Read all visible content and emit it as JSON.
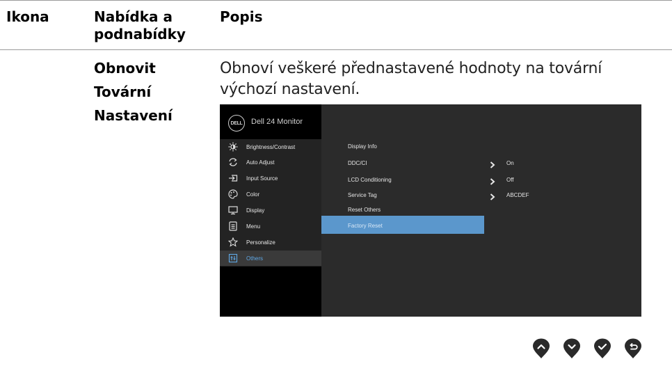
{
  "table": {
    "headers": {
      "icon": "Ikona",
      "menu_line1": "Nabídka a",
      "menu_line2": "podnabídky",
      "desc": "Popis"
    },
    "row": {
      "menu_lines": [
        "Obnovit",
        "Tovární",
        "Nastavení"
      ],
      "desc_lines": [
        "Obnoví veškeré přednastavené hodnoty na tovární",
        "výchozí nastavení."
      ]
    }
  },
  "osd": {
    "logo": "DELL",
    "title": "Dell 24 Monitor",
    "left_menu": [
      {
        "icon": "brightness-icon",
        "label": "Brightness/Contrast"
      },
      {
        "icon": "auto-adjust-icon",
        "label": "Auto Adjust"
      },
      {
        "icon": "input-source-icon",
        "label": "Input Source"
      },
      {
        "icon": "color-palette-icon",
        "label": "Color"
      },
      {
        "icon": "display-icon",
        "label": "Display"
      },
      {
        "icon": "menu-icon",
        "label": "Menu"
      },
      {
        "icon": "star-icon",
        "label": "Personalize"
      },
      {
        "icon": "others-icon",
        "label": "Others",
        "active": true
      }
    ],
    "right_menu": [
      {
        "label": "Display Info"
      },
      {
        "label": "DDC/CI",
        "value": "On"
      },
      {
        "label": "LCD Conditioning",
        "value": "Off"
      },
      {
        "label": "Service Tag",
        "value": "ABCDEF"
      },
      {
        "label": "Reset Others"
      },
      {
        "label": "Factory Reset",
        "highlighted": true
      }
    ],
    "colors": {
      "highlight": "#5b97cc",
      "active_text": "#5fa8e6",
      "panel": "#2b2b2b"
    }
  },
  "buttons": [
    {
      "icon": "up-arrow-icon"
    },
    {
      "icon": "down-arrow-icon"
    },
    {
      "icon": "checkmark-icon"
    },
    {
      "icon": "back-icon"
    }
  ]
}
